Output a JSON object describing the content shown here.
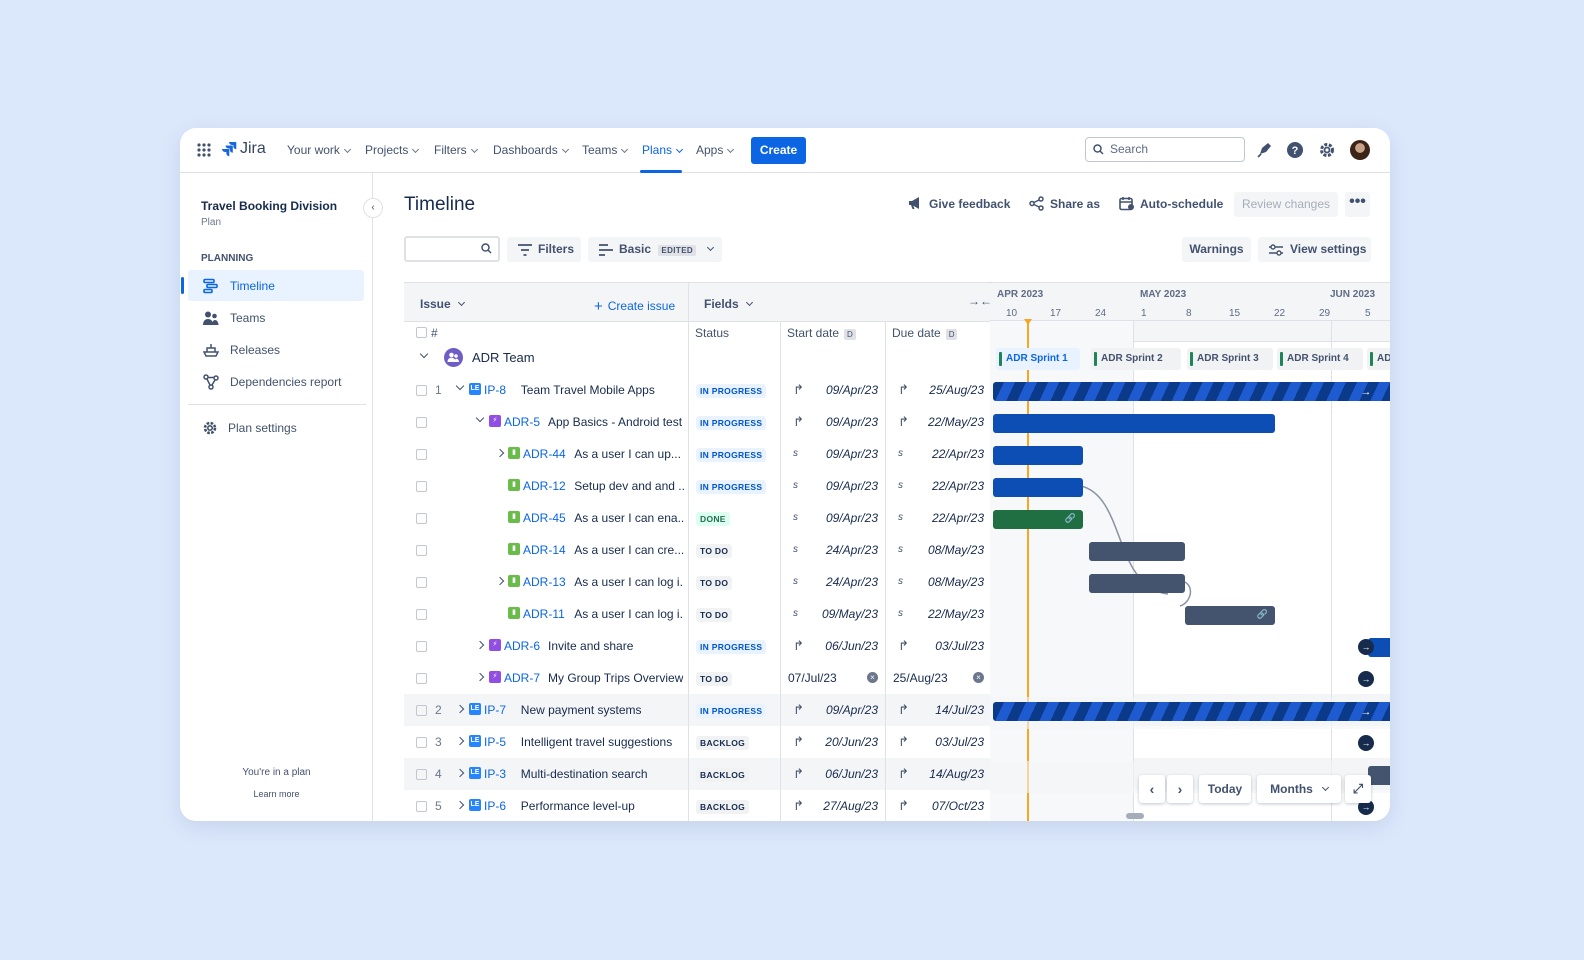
{
  "app": {
    "name": "Jira"
  },
  "nav": {
    "items": [
      {
        "label": "Your work"
      },
      {
        "label": "Projects"
      },
      {
        "label": "Filters"
      },
      {
        "label": "Dashboards"
      },
      {
        "label": "Teams"
      },
      {
        "label": "Plans"
      },
      {
        "label": "Apps"
      }
    ],
    "active": "Plans",
    "create_label": "Create",
    "search_placeholder": "Search"
  },
  "sidebar": {
    "plan_name": "Travel Booking Division",
    "plan_type": "Plan",
    "section": "PLANNING",
    "items": [
      {
        "label": "Timeline",
        "icon": "timeline-icon",
        "active": true
      },
      {
        "label": "Teams",
        "icon": "people-icon"
      },
      {
        "label": "Releases",
        "icon": "ship-icon"
      },
      {
        "label": "Dependencies report",
        "icon": "dependencies-icon"
      }
    ],
    "settings_label": "Plan settings",
    "footer_text": "You're in a plan",
    "footer_link": "Learn more"
  },
  "page": {
    "title": "Timeline",
    "actions": {
      "give_feedback": "Give feedback",
      "share_as": "Share as",
      "auto_schedule": "Auto-schedule",
      "review_changes": "Review changes"
    },
    "toolbar": {
      "filters": "Filters",
      "view_name": "Basic",
      "view_badge": "EDITED",
      "warnings": "Warnings",
      "view_settings": "View settings"
    }
  },
  "grid": {
    "issue_header": "Issue",
    "create_issue": "Create issue",
    "fields_header": "Fields",
    "col_hash": "#",
    "col_status": "Status",
    "col_start": "Start date",
    "col_due": "Due date",
    "date_badge": "D",
    "team_name": "ADR Team",
    "rows": [
      {
        "num": "1",
        "type": "LE",
        "key": "IP-8",
        "summary": "Team Travel Mobile Apps",
        "status": "IN PROGRESS",
        "start": "09/Apr/23",
        "due": "25/Aug/23"
      },
      {
        "num": "",
        "type": "E",
        "key": "ADR-5",
        "summary": "App Basics - Android test",
        "status": "IN PROGRESS",
        "start": "09/Apr/23",
        "due": "22/May/23"
      },
      {
        "num": "",
        "type": "S",
        "key": "ADR-44",
        "summary": "As a user I can up...",
        "status": "IN PROGRESS",
        "start": "09/Apr/23",
        "due": "22/Apr/23"
      },
      {
        "num": "",
        "type": "S",
        "key": "ADR-12",
        "summary": "Setup dev and and ...",
        "status": "IN PROGRESS",
        "start": "09/Apr/23",
        "due": "22/Apr/23"
      },
      {
        "num": "",
        "type": "S",
        "key": "ADR-45",
        "summary": "As a user I can ena...",
        "status": "DONE",
        "start": "09/Apr/23",
        "due": "22/Apr/23"
      },
      {
        "num": "",
        "type": "S",
        "key": "ADR-14",
        "summary": "As a user I can cre...",
        "status": "TO DO",
        "start": "24/Apr/23",
        "due": "08/May/23"
      },
      {
        "num": "",
        "type": "S",
        "key": "ADR-13",
        "summary": "As a user I can log i...",
        "status": "TO DO",
        "start": "24/Apr/23",
        "due": "08/May/23"
      },
      {
        "num": "",
        "type": "S",
        "key": "ADR-11",
        "summary": "As a user I can log i...",
        "status": "TO DO",
        "start": "09/May/23",
        "due": "22/May/23"
      },
      {
        "num": "",
        "type": "E",
        "key": "ADR-6",
        "summary": "Invite and share",
        "status": "IN PROGRESS",
        "start": "06/Jun/23",
        "due": "03/Jul/23"
      },
      {
        "num": "",
        "type": "E",
        "key": "ADR-7",
        "summary": "My Group Trips Overview",
        "status": "TO DO",
        "start": "07/Jul/23",
        "due": "25/Aug/23"
      },
      {
        "num": "2",
        "type": "LE",
        "key": "IP-7",
        "summary": "New payment systems",
        "status": "IN PROGRESS",
        "start": "09/Apr/23",
        "due": "14/Jul/23"
      },
      {
        "num": "3",
        "type": "LE",
        "key": "IP-5",
        "summary": "Intelligent travel suggestions",
        "status": "BACKLOG",
        "start": "20/Jun/23",
        "due": "03/Jul/23"
      },
      {
        "num": "4",
        "type": "LE",
        "key": "IP-3",
        "summary": "Multi-destination search",
        "status": "BACKLOG",
        "start": "06/Jun/23",
        "due": "14/Aug/23"
      },
      {
        "num": "5",
        "type": "LE",
        "key": "IP-6",
        "summary": "Performance level-up",
        "status": "BACKLOG",
        "start": "27/Aug/23",
        "due": "07/Oct/23"
      }
    ]
  },
  "timeline": {
    "months": [
      "APR 2023",
      "MAY 2023",
      "JUN 2023"
    ],
    "days": [
      "10",
      "17",
      "24",
      "1",
      "8",
      "15",
      "22",
      "29",
      "5"
    ],
    "sprints": [
      "ADR Sprint 1",
      "ADR Sprint 2",
      "ADR Sprint 3",
      "ADR Sprint 4",
      "AD"
    ],
    "controls": {
      "today": "Today",
      "scale": "Months"
    }
  },
  "colors": {
    "accent": "#0c66e4",
    "today_line": "#f5a623",
    "bar_blue": "#0c4eb3",
    "bar_green": "#1f6f43",
    "bar_slate": "#44546f"
  }
}
